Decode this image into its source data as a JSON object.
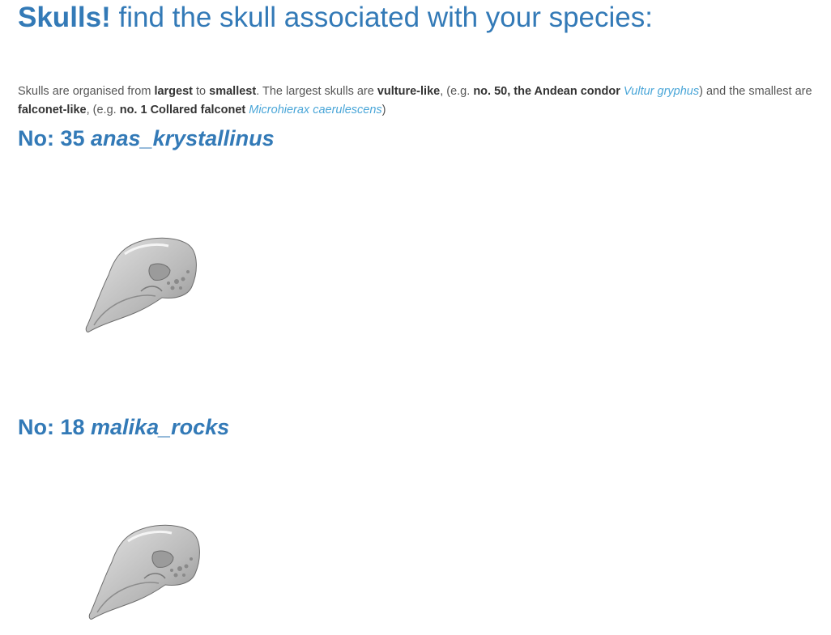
{
  "header": {
    "title_bold": "Skulls!",
    "title_rest": " find the skull associated with your species:"
  },
  "intro": {
    "t1": "Skulls are organised from ",
    "b1": "largest",
    "t2": " to ",
    "b2": "smallest",
    "t3": ". The largest skulls are ",
    "b3": "vulture-like",
    "t4": ", (e.g. ",
    "b4": "no. 50, the Andean condor",
    "t5": " ",
    "link1": "Vultur gryphus",
    "t6": ") and the smallest are ",
    "b5": "falconet-like",
    "t7": ", (e.g. ",
    "b6": "no. 1 Collared falconet",
    "t8": " ",
    "link2": "Microhierax caerulescens",
    "t9": ")"
  },
  "entries": [
    {
      "number_label": "No: 35 ",
      "species": "anas_krystallinus"
    },
    {
      "number_label": "No: 18 ",
      "species": "malika_rocks"
    }
  ]
}
